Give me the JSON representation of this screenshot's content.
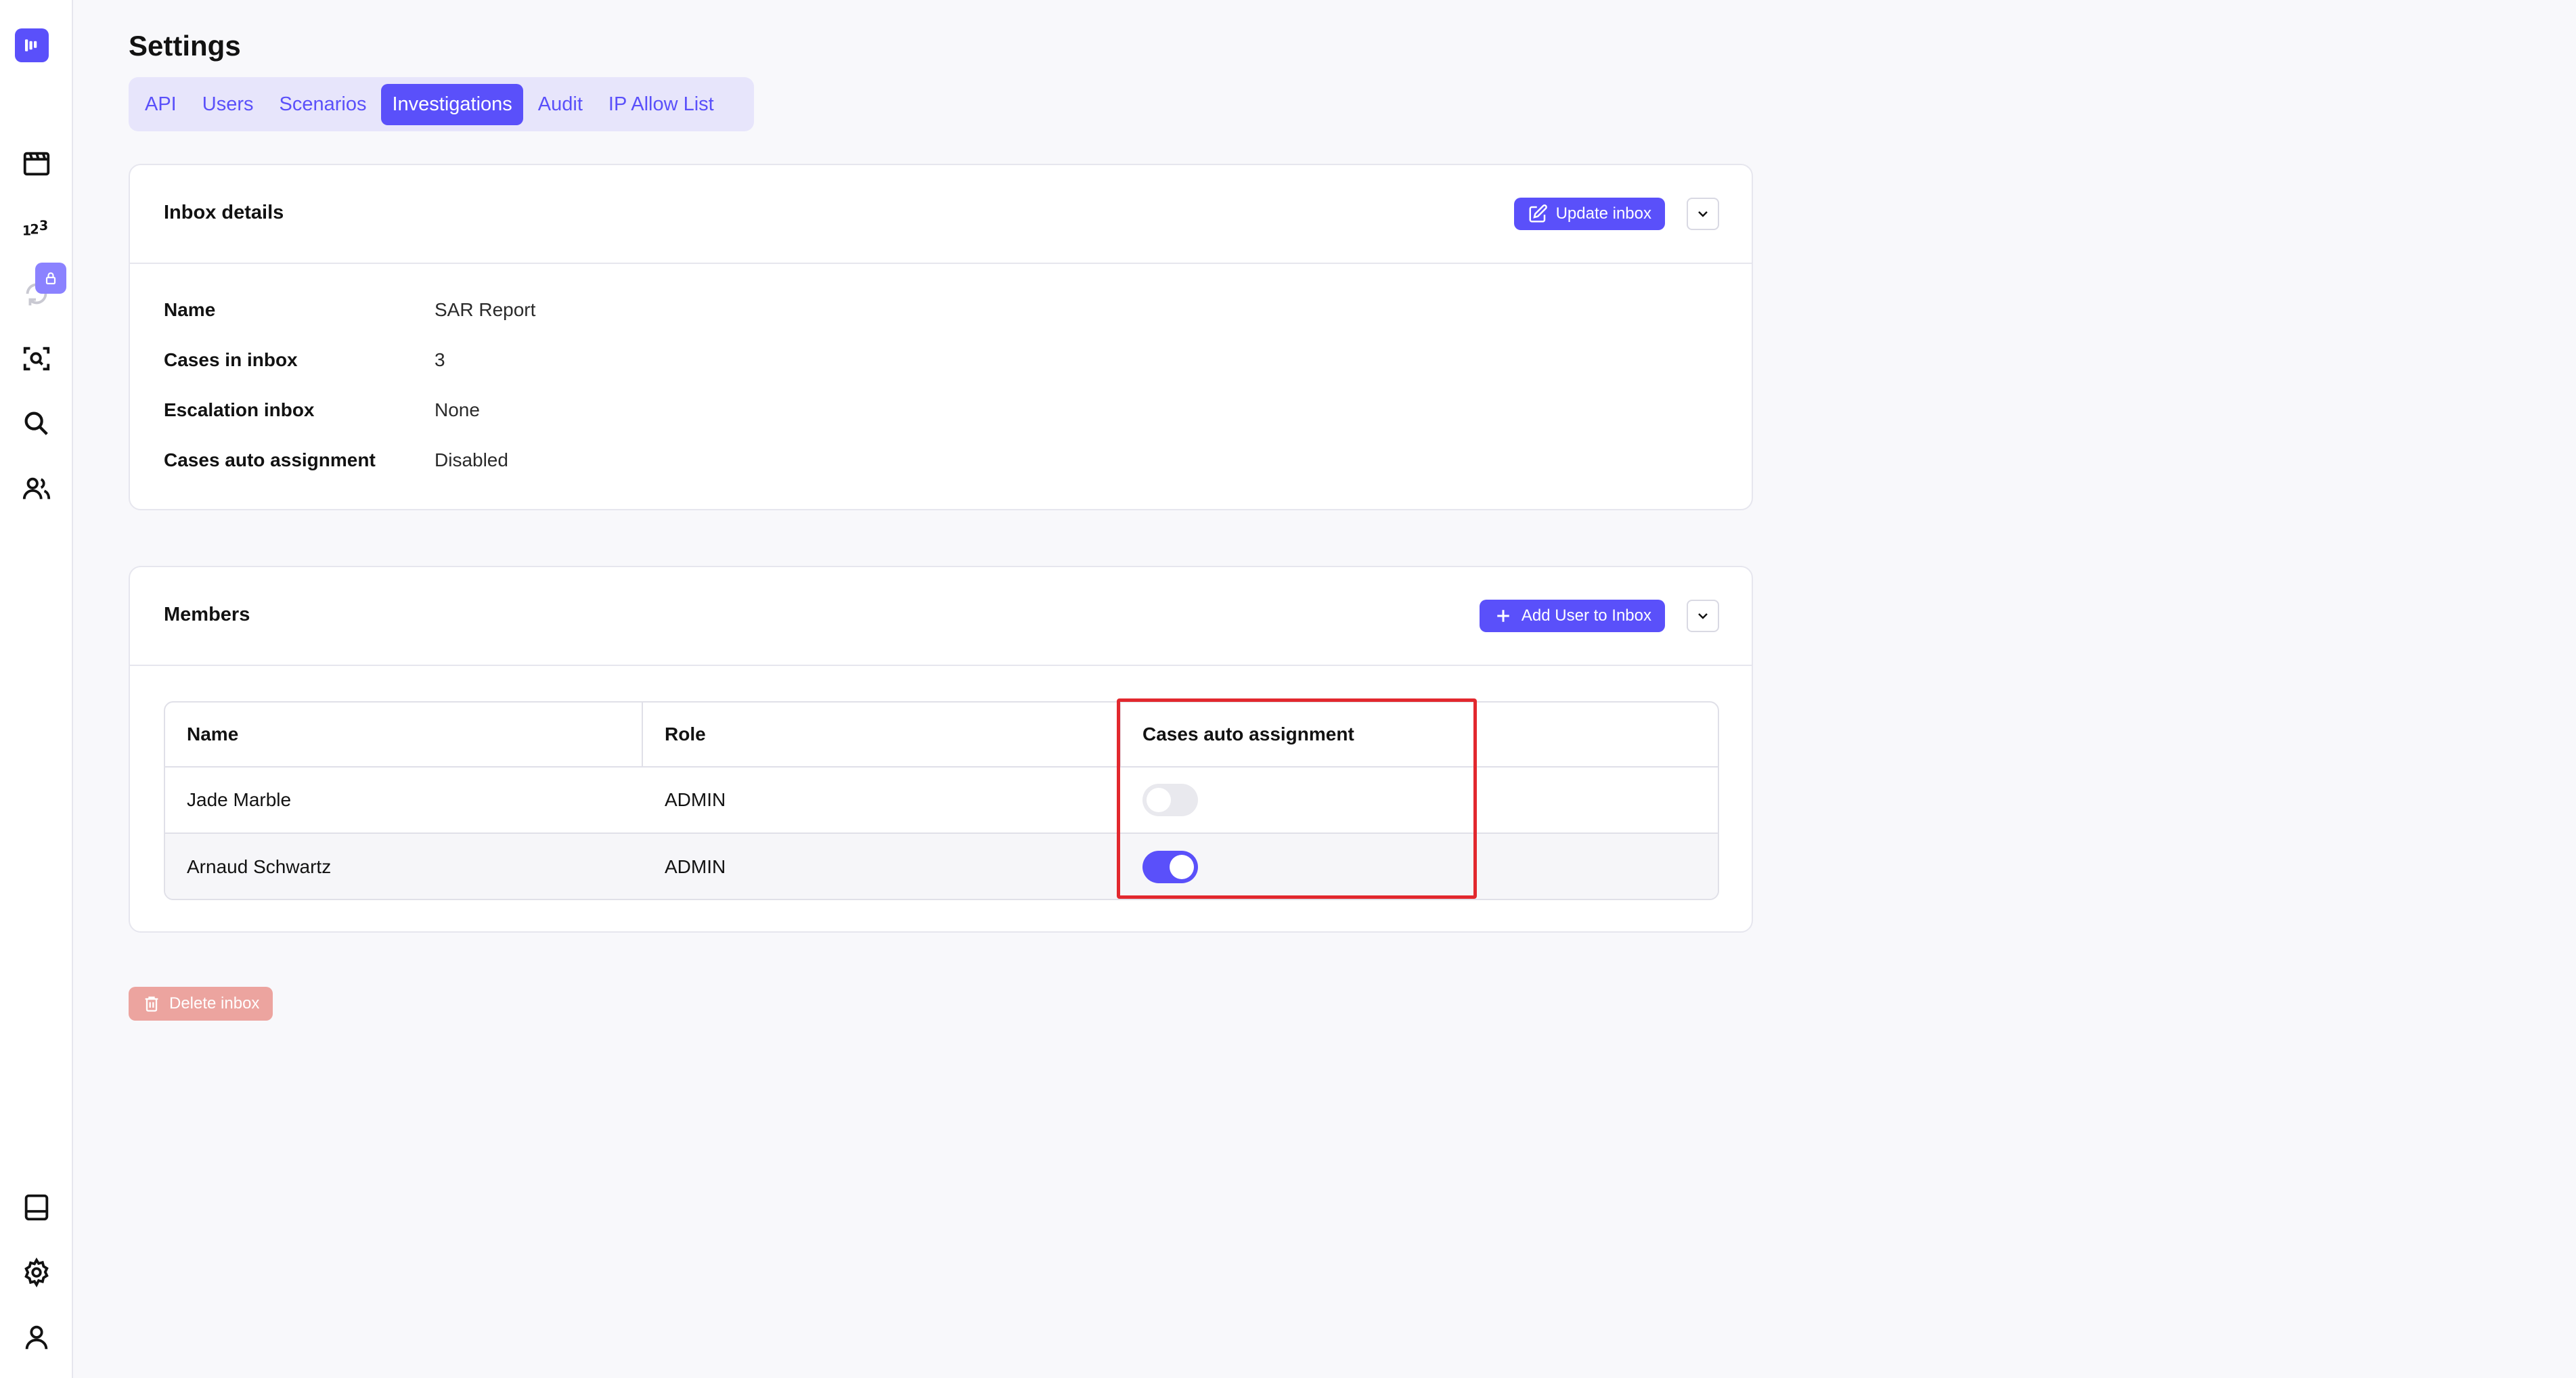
{
  "sidebar": {
    "icons": [
      "logo-icon",
      "film-icon",
      "numbers-icon",
      "recycle-icon",
      "lock-icon",
      "scan-icon",
      "search-icon",
      "users-icon",
      "panel-icon",
      "gear-icon",
      "user-icon"
    ]
  },
  "page": {
    "title": "Settings"
  },
  "tabs": [
    {
      "label": "API",
      "active": false
    },
    {
      "label": "Users",
      "active": false
    },
    {
      "label": "Scenarios",
      "active": false
    },
    {
      "label": "Investigations",
      "active": true
    },
    {
      "label": "Audit",
      "active": false
    },
    {
      "label": "IP Allow List",
      "active": false
    }
  ],
  "inbox_details": {
    "title": "Inbox details",
    "update_button": "Update inbox",
    "rows": [
      {
        "label": "Name",
        "value": "SAR Report"
      },
      {
        "label": "Cases in inbox",
        "value": "3"
      },
      {
        "label": "Escalation inbox",
        "value": "None"
      },
      {
        "label": "Cases auto assignment",
        "value": "Disabled"
      }
    ]
  },
  "members": {
    "title": "Members",
    "add_button": "Add User to Inbox",
    "columns": [
      "Name",
      "Role",
      "Cases auto assignment"
    ],
    "rows": [
      {
        "name": "Jade Marble",
        "role": "ADMIN",
        "auto_assignment": false
      },
      {
        "name": "Arnaud Schwartz",
        "role": "ADMIN",
        "auto_assignment": true
      }
    ]
  },
  "delete_button": "Delete inbox",
  "colors": {
    "accent": "#5a50fa",
    "highlight": "#e2282e",
    "danger_disabled": "#eca49f"
  }
}
